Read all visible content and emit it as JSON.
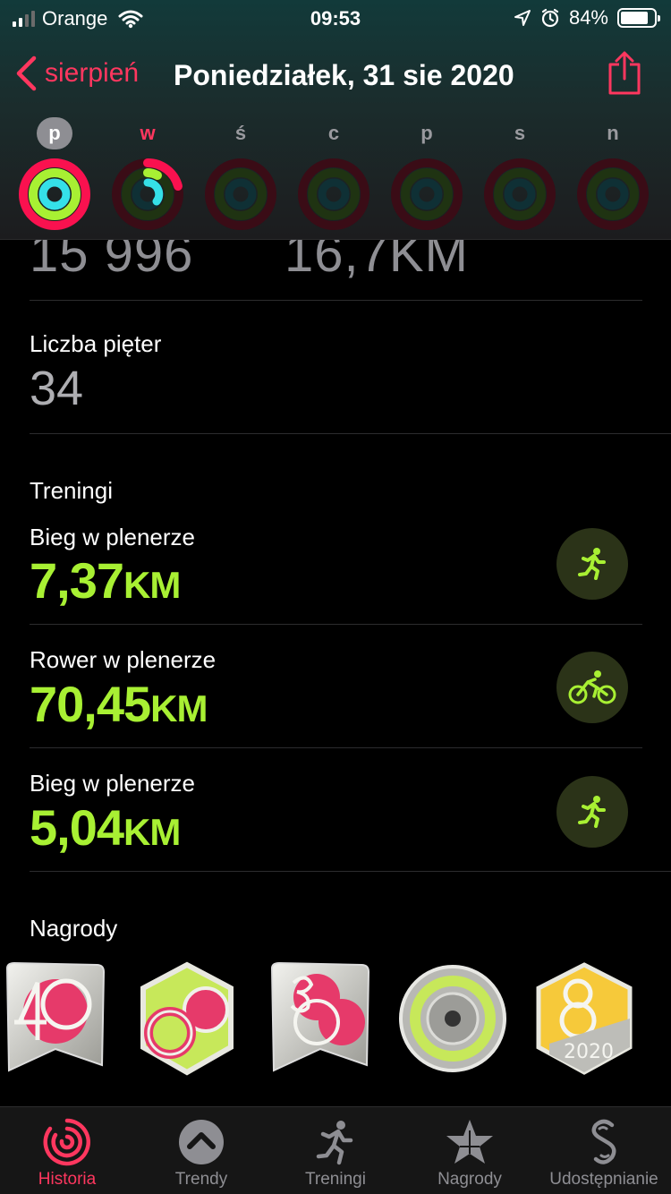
{
  "status_bar": {
    "carrier": "Orange",
    "time": "09:53",
    "battery": "84%",
    "battery_level": 0.84
  },
  "nav": {
    "back_label": "sierpień",
    "title": "Poniedziałek, 31 sie 2020"
  },
  "week_days": [
    "p",
    "w",
    "ś",
    "c",
    "p",
    "s",
    "n"
  ],
  "summary": {
    "steps_partial": "15 996",
    "distance_partial": "16,7KM"
  },
  "floors": {
    "label": "Liczba pięter",
    "value": "34"
  },
  "workouts": {
    "title": "Treningi",
    "items": [
      {
        "name": "Bieg w plenerze",
        "value": "7,37",
        "unit": "KM",
        "icon": "running-icon"
      },
      {
        "name": "Rower w plenerze",
        "value": "70,45",
        "unit": "KM",
        "icon": "cycling-icon"
      },
      {
        "name": "Bieg w plenerze",
        "value": "5,04",
        "unit": "KM",
        "icon": "running-icon"
      }
    ]
  },
  "awards": {
    "title": "Nagrody"
  },
  "tabbar": {
    "items": [
      {
        "label": "Historia",
        "active": true
      },
      {
        "label": "Trendy",
        "active": false
      },
      {
        "label": "Treningi",
        "active": false
      },
      {
        "label": "Nagrody",
        "active": false
      },
      {
        "label": "Udostępnianie",
        "active": false
      }
    ]
  },
  "colors": {
    "accent": "#ff375f",
    "move": "#fa114f",
    "exercise": "#a8f033",
    "stand": "#35e0e8",
    "background": "#000000"
  }
}
